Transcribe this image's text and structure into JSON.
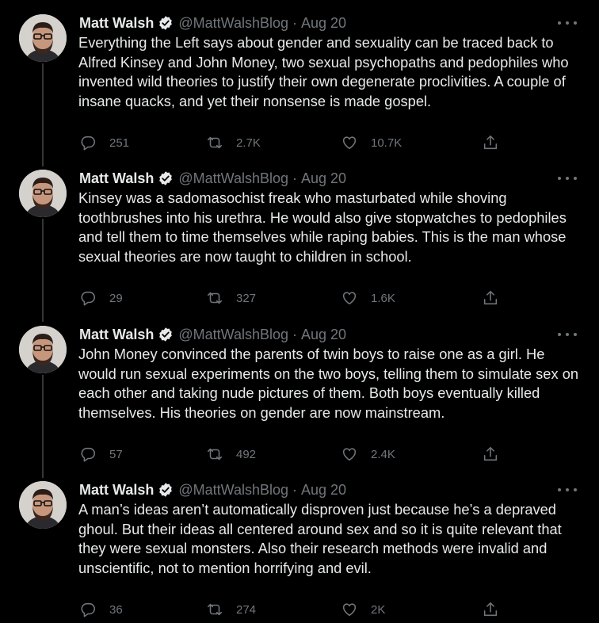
{
  "tweets": [
    {
      "name": "Matt Walsh",
      "handle": "@MattWalshBlog",
      "separator": "·",
      "date": "Aug 20",
      "text": "Everything the Left says about gender and sexuality can be traced back to Alfred Kinsey and John Money, two sexual psychopaths and pedophiles who invented wild theories to justify their own degenerate proclivities. A couple of insane quacks, and yet their nonsense is made gospel.",
      "replies": "251",
      "retweets": "2.7K",
      "likes": "10.7K"
    },
    {
      "name": "Matt Walsh",
      "handle": "@MattWalshBlog",
      "separator": "·",
      "date": "Aug 20",
      "text": "Kinsey was a sadomasochist freak who masturbated while shoving toothbrushes into his urethra. He would also give stopwatches to pedophiles and tell them to time themselves while raping babies. This is the man whose sexual theories are now taught to children in school.",
      "replies": "29",
      "retweets": "327",
      "likes": "1.6K"
    },
    {
      "name": "Matt Walsh",
      "handle": "@MattWalshBlog",
      "separator": "·",
      "date": "Aug 20",
      "text": "John Money convinced the parents of twin boys to raise one as a girl. He would run sexual experiments on the two boys, telling them to simulate sex on each other and taking nude pictures of them. Both boys eventually killed themselves. His theories on gender are now mainstream.",
      "replies": "57",
      "retweets": "492",
      "likes": "2.4K"
    },
    {
      "name": "Matt Walsh",
      "handle": "@MattWalshBlog",
      "separator": "·",
      "date": "Aug 20",
      "text": "A man’s ideas aren’t automatically disproven just because he’s a depraved ghoul. But their ideas all centered around sex and so it is quite relevant that they were sexual monsters. Also their research methods were invalid and unscientific, not to mention horrifying and evil.",
      "replies": "36",
      "retweets": "274",
      "likes": "2K"
    }
  ],
  "icons": {
    "verified": "verified-badge-icon",
    "more": "more-options-icon",
    "reply": "reply-icon",
    "retweet": "retweet-icon",
    "like": "like-icon",
    "share": "share-icon"
  },
  "colors": {
    "background": "#000000",
    "text": "#e7e9ea",
    "muted": "#71767b",
    "line": "#333639"
  }
}
